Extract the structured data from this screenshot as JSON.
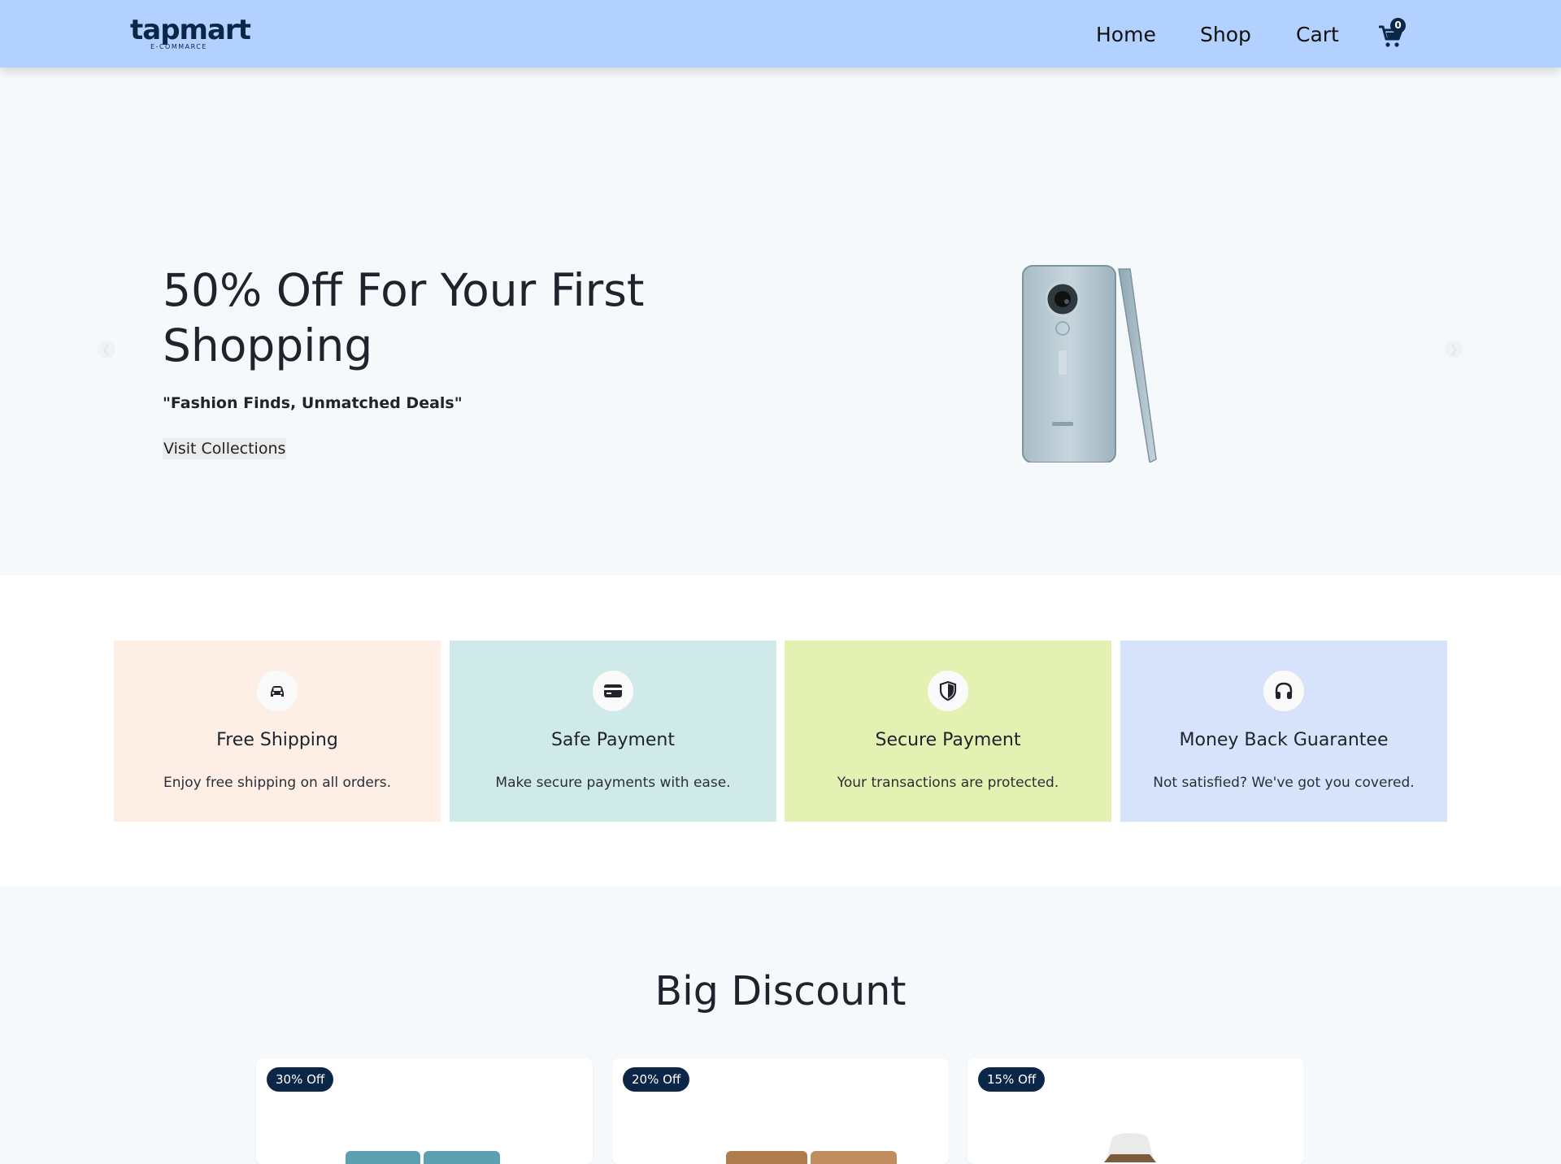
{
  "header": {
    "logo_word": "tapmart",
    "logo_sub": "E-COMMARCE",
    "nav": {
      "home": "Home",
      "shop": "Shop",
      "cart": "Cart"
    },
    "cart_count": "0",
    "cart_icon": "shopping-cart-icon"
  },
  "hero": {
    "title": "50% Off For Your First Shopping",
    "tagline": "\"Fashion Finds, Unmatched Deals\"",
    "button_label": "Visit Collections",
    "prev_icon": "chevron-left-icon",
    "next_icon": "chevron-right-icon"
  },
  "features": [
    {
      "icon": "car-icon",
      "title": "Free Shipping",
      "desc": "Enjoy free shipping on all orders.",
      "bg": "#fdeee6"
    },
    {
      "icon": "credit-card-icon",
      "title": "Safe Payment",
      "desc": "Make secure payments with ease.",
      "bg": "#d0e9e9"
    },
    {
      "icon": "shield-icon",
      "title": "Secure Payment",
      "desc": "Your transactions are protected.",
      "bg": "#e3f2b3"
    },
    {
      "icon": "headphones-icon",
      "title": "Money Back Guarantee",
      "desc": "Not satisfied? We've got you covered.",
      "bg": "#d6e3fb"
    }
  ],
  "discount": {
    "title": "Big Discount",
    "products": [
      {
        "badge": "30% Off"
      },
      {
        "badge": "20% Off"
      },
      {
        "badge": "15% Off"
      }
    ]
  },
  "colors": {
    "navbar": "#b3d1fe",
    "brand_dark": "#0b2647",
    "page_bg": "#f6f9fc"
  }
}
